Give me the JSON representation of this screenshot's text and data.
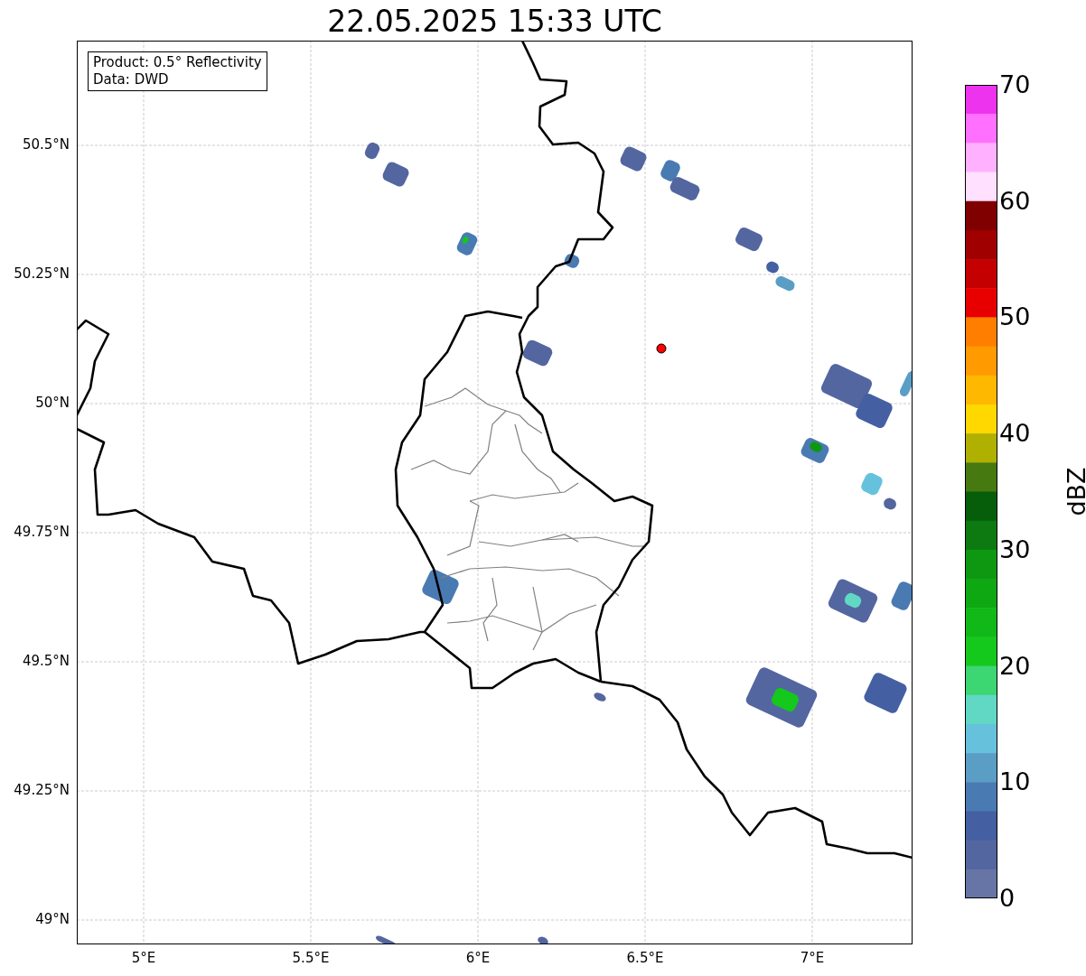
{
  "title": "22.05.2025 15:33 UTC",
  "info_box": {
    "lines": [
      "Product: 0.5° Reflectivity",
      "Data: DWD"
    ]
  },
  "map": {
    "lat_ticks": [
      "50.5°N",
      "50.25°N",
      "50°N",
      "49.75°N",
      "49.5°N",
      "49.25°N",
      "49°N"
    ],
    "lon_ticks": [
      "5°E",
      "5.5°E",
      "6°E",
      "6.5°E",
      "7°E"
    ]
  },
  "colorbar": {
    "label": "dBZ",
    "ticks": [
      "70",
      "60",
      "50",
      "40",
      "30",
      "20",
      "10",
      "0"
    ],
    "bands": [
      {
        "color": "#ee33ee"
      },
      {
        "color": "#ff70ff"
      },
      {
        "color": "#ffb0ff"
      },
      {
        "color": "#ffe0ff"
      },
      {
        "color": "#800000"
      },
      {
        "color": "#a00000"
      },
      {
        "color": "#c40000"
      },
      {
        "color": "#e80000"
      },
      {
        "color": "#ff7e00"
      },
      {
        "color": "#ff9a00"
      },
      {
        "color": "#ffb800"
      },
      {
        "color": "#ffd800"
      },
      {
        "color": "#b0b000"
      },
      {
        "color": "#467a10"
      },
      {
        "color": "#065e0a"
      },
      {
        "color": "#0c7a10"
      },
      {
        "color": "#0e9812"
      },
      {
        "color": "#0ea812"
      },
      {
        "color": "#10b818"
      },
      {
        "color": "#14c81c"
      },
      {
        "color": "#3cd672"
      },
      {
        "color": "#60d8c4"
      },
      {
        "color": "#66c2dc"
      },
      {
        "color": "#5a9ec6"
      },
      {
        "color": "#4a7ab2"
      },
      {
        "color": "#4460a2"
      },
      {
        "color": "#5466a0"
      },
      {
        "color": "#6674a6"
      }
    ]
  }
}
